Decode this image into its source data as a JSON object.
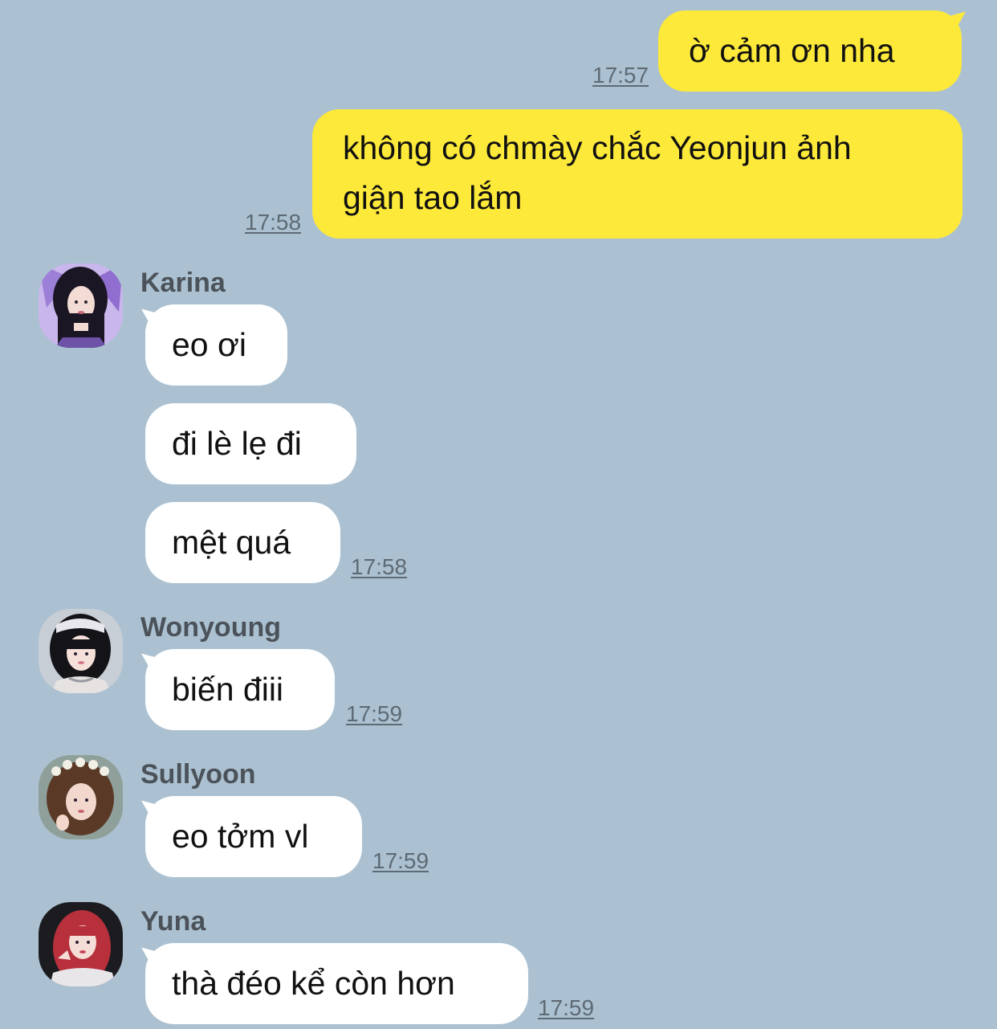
{
  "colors": {
    "background": "#abc1d1",
    "my_bubble": "#fde93a",
    "their_bubble": "#ffffff",
    "sender_name": "#4b5259",
    "timestamp": "#5e6a74"
  },
  "outgoing": [
    {
      "text": "ờ cảm ơn nha",
      "time": "17:57"
    },
    {
      "text_line1": "không có chmày chắc Yeonjun ảnh",
      "text_line2": "giận tao lắm",
      "time": "17:58"
    }
  ],
  "senders": [
    {
      "name": "Karina",
      "avatar": "karina-avatar",
      "messages": [
        "eo ơi",
        "đi lè lẹ đi",
        "mệt quá"
      ],
      "time": "17:58"
    },
    {
      "name": "Wonyoung",
      "avatar": "wonyoung-avatar",
      "messages": [
        "biến điii"
      ],
      "time": "17:59"
    },
    {
      "name": "Sullyoon",
      "avatar": "sullyoon-avatar",
      "messages": [
        "eo tởm vl"
      ],
      "time": "17:59"
    },
    {
      "name": "Yuna",
      "avatar": "yuna-avatar",
      "messages": [
        "thà đéo kể còn hơn"
      ],
      "time": "17:59"
    }
  ]
}
